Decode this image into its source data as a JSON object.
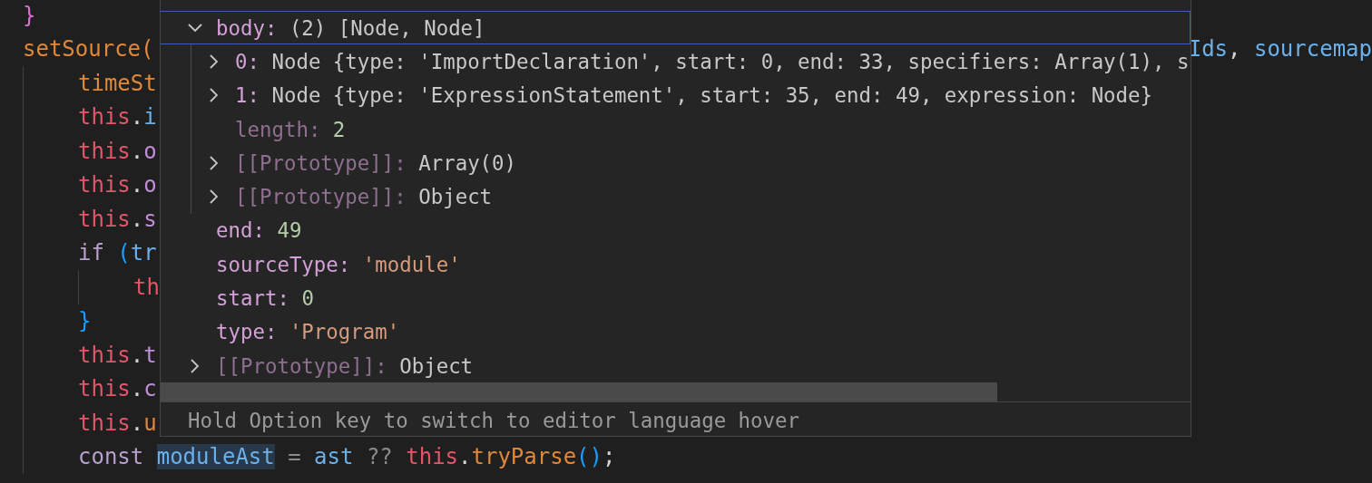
{
  "editor": {
    "lines": [
      {
        "tokens": [
          {
            "text": "}",
            "kind": "bracket1"
          }
        ]
      },
      {
        "tokens": [
          {
            "text": "setSource(",
            "kind": "func"
          }
        ],
        "tail": [
          {
            "text": "Ids",
            "kind": "var"
          },
          {
            "text": ", ",
            "kind": "punct"
          },
          {
            "text": "sourcemap",
            "kind": "var"
          }
        ],
        "children": [
          {
            "tokens": [
              {
                "text": "timeSt",
                "kind": "func"
              }
            ]
          },
          {
            "tokens": [
              {
                "text": "this",
                "kind": "this"
              },
              {
                "text": ".",
                "kind": "punct"
              },
              {
                "text": "i",
                "kind": "var"
              }
            ]
          },
          {
            "tokens": [
              {
                "text": "this",
                "kind": "this"
              },
              {
                "text": ".",
                "kind": "punct"
              },
              {
                "text": "o",
                "kind": "prop"
              }
            ]
          },
          {
            "tokens": [
              {
                "text": "this",
                "kind": "this"
              },
              {
                "text": ".",
                "kind": "punct"
              },
              {
                "text": "o",
                "kind": "prop"
              }
            ]
          },
          {
            "tokens": [
              {
                "text": "this",
                "kind": "this"
              },
              {
                "text": ".",
                "kind": "punct"
              },
              {
                "text": "s",
                "kind": "prop"
              }
            ]
          },
          {
            "tokens": [
              {
                "text": "if ",
                "kind": "keyword"
              },
              {
                "text": "(",
                "kind": "bracket2"
              },
              {
                "text": "tr",
                "kind": "var"
              }
            ],
            "children": [
              {
                "tokens": [
                  {
                    "text": "th",
                    "kind": "this"
                  }
                ]
              }
            ]
          },
          {
            "tokens": [
              {
                "text": "}",
                "kind": "bracket2"
              }
            ]
          },
          {
            "tokens": [
              {
                "text": "this",
                "kind": "this"
              },
              {
                "text": ".",
                "kind": "punct"
              },
              {
                "text": "t",
                "kind": "prop"
              }
            ]
          },
          {
            "tokens": [
              {
                "text": "this",
                "kind": "this"
              },
              {
                "text": ".",
                "kind": "punct"
              },
              {
                "text": "c",
                "kind": "prop"
              }
            ]
          },
          {
            "tokens": [
              {
                "text": "this",
                "kind": "this"
              },
              {
                "text": ".",
                "kind": "punct"
              },
              {
                "text": "u",
                "kind": "func"
              }
            ]
          },
          {
            "tokens": [
              {
                "text": "const ",
                "kind": "keyword"
              },
              {
                "text": "moduleAst",
                "kind": "highlight"
              },
              {
                "text": " = ",
                "kind": "op"
              },
              {
                "text": "ast",
                "kind": "var"
              },
              {
                "text": " ?? ",
                "kind": "op"
              },
              {
                "text": "this",
                "kind": "this"
              },
              {
                "text": ".",
                "kind": "punct"
              },
              {
                "text": "tryParse",
                "kind": "func"
              },
              {
                "text": "()",
                "kind": "bracket2"
              },
              {
                "text": ";",
                "kind": "punct"
              }
            ]
          }
        ]
      }
    ]
  },
  "hover": {
    "rows": [
      {
        "kind": "node",
        "expanded": true,
        "selected": true,
        "tokens": [
          {
            "text": "body: ",
            "kind": "key"
          },
          {
            "text": "(2) [Node, Node]",
            "kind": "object"
          }
        ],
        "children": [
          {
            "kind": "node",
            "expanded": false,
            "selected": false,
            "tokens": [
              {
                "text": "0: ",
                "kind": "key"
              },
              {
                "text": "Node {type: 'ImportDeclaration', start: 0, end: 33, specifiers: Array(1), s",
                "kind": "object"
              }
            ]
          },
          {
            "kind": "node",
            "expanded": false,
            "selected": false,
            "tokens": [
              {
                "text": "1: ",
                "kind": "key"
              },
              {
                "text": "Node {type: 'ExpressionStatement', start: 35, end: 49, expression: Node}",
                "kind": "object"
              }
            ]
          },
          {
            "kind": "leaf",
            "selected": false,
            "tokens": [
              {
                "text": "length: ",
                "kind": "internal"
              },
              {
                "text": "2",
                "kind": "number"
              }
            ]
          },
          {
            "kind": "node",
            "expanded": false,
            "selected": false,
            "tokens": [
              {
                "text": "[[Prototype]]: ",
                "kind": "internal"
              },
              {
                "text": "Array(0)",
                "kind": "object"
              }
            ]
          },
          {
            "kind": "node",
            "expanded": false,
            "selected": false,
            "tokens": [
              {
                "text": "[[Prototype]]: ",
                "kind": "internal"
              },
              {
                "text": "Object",
                "kind": "object"
              }
            ]
          }
        ]
      },
      {
        "kind": "leaf",
        "selected": false,
        "tokens": [
          {
            "text": "end: ",
            "kind": "key"
          },
          {
            "text": "49",
            "kind": "number"
          }
        ]
      },
      {
        "kind": "leaf",
        "selected": false,
        "tokens": [
          {
            "text": "sourceType: ",
            "kind": "key"
          },
          {
            "text": "'module'",
            "kind": "string"
          }
        ]
      },
      {
        "kind": "leaf",
        "selected": false,
        "tokens": [
          {
            "text": "start: ",
            "kind": "key"
          },
          {
            "text": "0",
            "kind": "number"
          }
        ]
      },
      {
        "kind": "leaf",
        "selected": false,
        "tokens": [
          {
            "text": "type: ",
            "kind": "key"
          },
          {
            "text": "'Program'",
            "kind": "string"
          }
        ]
      },
      {
        "kind": "node",
        "expanded": false,
        "selected": false,
        "tokens": [
          {
            "text": "[[Prototype]]: ",
            "kind": "internal"
          },
          {
            "text": "Object",
            "kind": "object"
          }
        ]
      }
    ],
    "status": "Hold Option key to switch to editor language hover"
  }
}
